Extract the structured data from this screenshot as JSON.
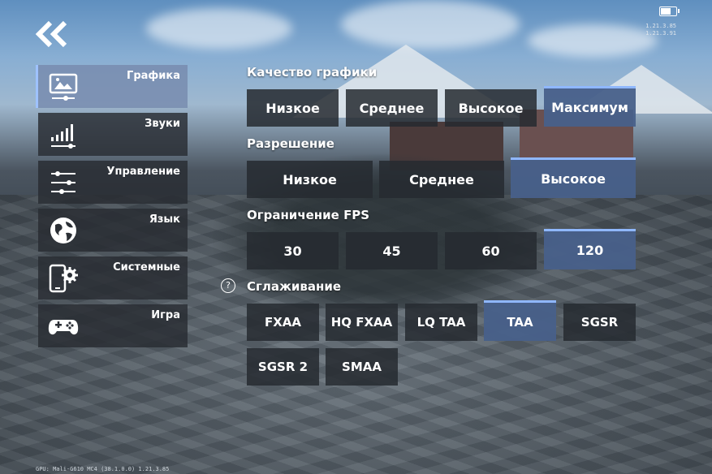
{
  "header": {
    "back_icon": "double-chevron-left-icon",
    "battery_icon": "battery-icon",
    "version_lines": [
      "1.21.3.85",
      "1.21.3.91"
    ]
  },
  "footer": {
    "gpu_info": "GPU: Mali-G610 MC4 (38.1.0.0)  1.21.3.85"
  },
  "sidebar": {
    "items": [
      {
        "label": "Графика",
        "icon": "display-settings-icon",
        "active": true
      },
      {
        "label": "Звуки",
        "icon": "volume-bars-icon",
        "active": false
      },
      {
        "label": "Управление",
        "icon": "sliders-icon",
        "active": false
      },
      {
        "label": "Язык",
        "icon": "globe-icon",
        "active": false
      },
      {
        "label": "Системные",
        "icon": "phone-gear-icon",
        "active": false
      },
      {
        "label": "Игра",
        "icon": "gamepad-icon",
        "active": false
      }
    ]
  },
  "graphics_quality": {
    "title": "Качество графики",
    "options": [
      "Низкое",
      "Среднее",
      "Высокое",
      "Максимум"
    ],
    "selected": "Максимум"
  },
  "resolution": {
    "title": "Разрешение",
    "options": [
      "Низкое",
      "Среднее",
      "Высокое"
    ],
    "selected": "Высокое"
  },
  "fps_limit": {
    "title": "Ограничение FPS",
    "options": [
      "30",
      "45",
      "60",
      "120"
    ],
    "selected": "120"
  },
  "antialiasing": {
    "title": "Сглаживание",
    "help_icon": "question-mark-icon",
    "help_text": "?",
    "options": [
      "FXAA",
      "HQ FXAA",
      "LQ TAA",
      "TAA",
      "SGSR",
      "SGSR 2",
      "SMAA"
    ],
    "selected": "TAA"
  }
}
